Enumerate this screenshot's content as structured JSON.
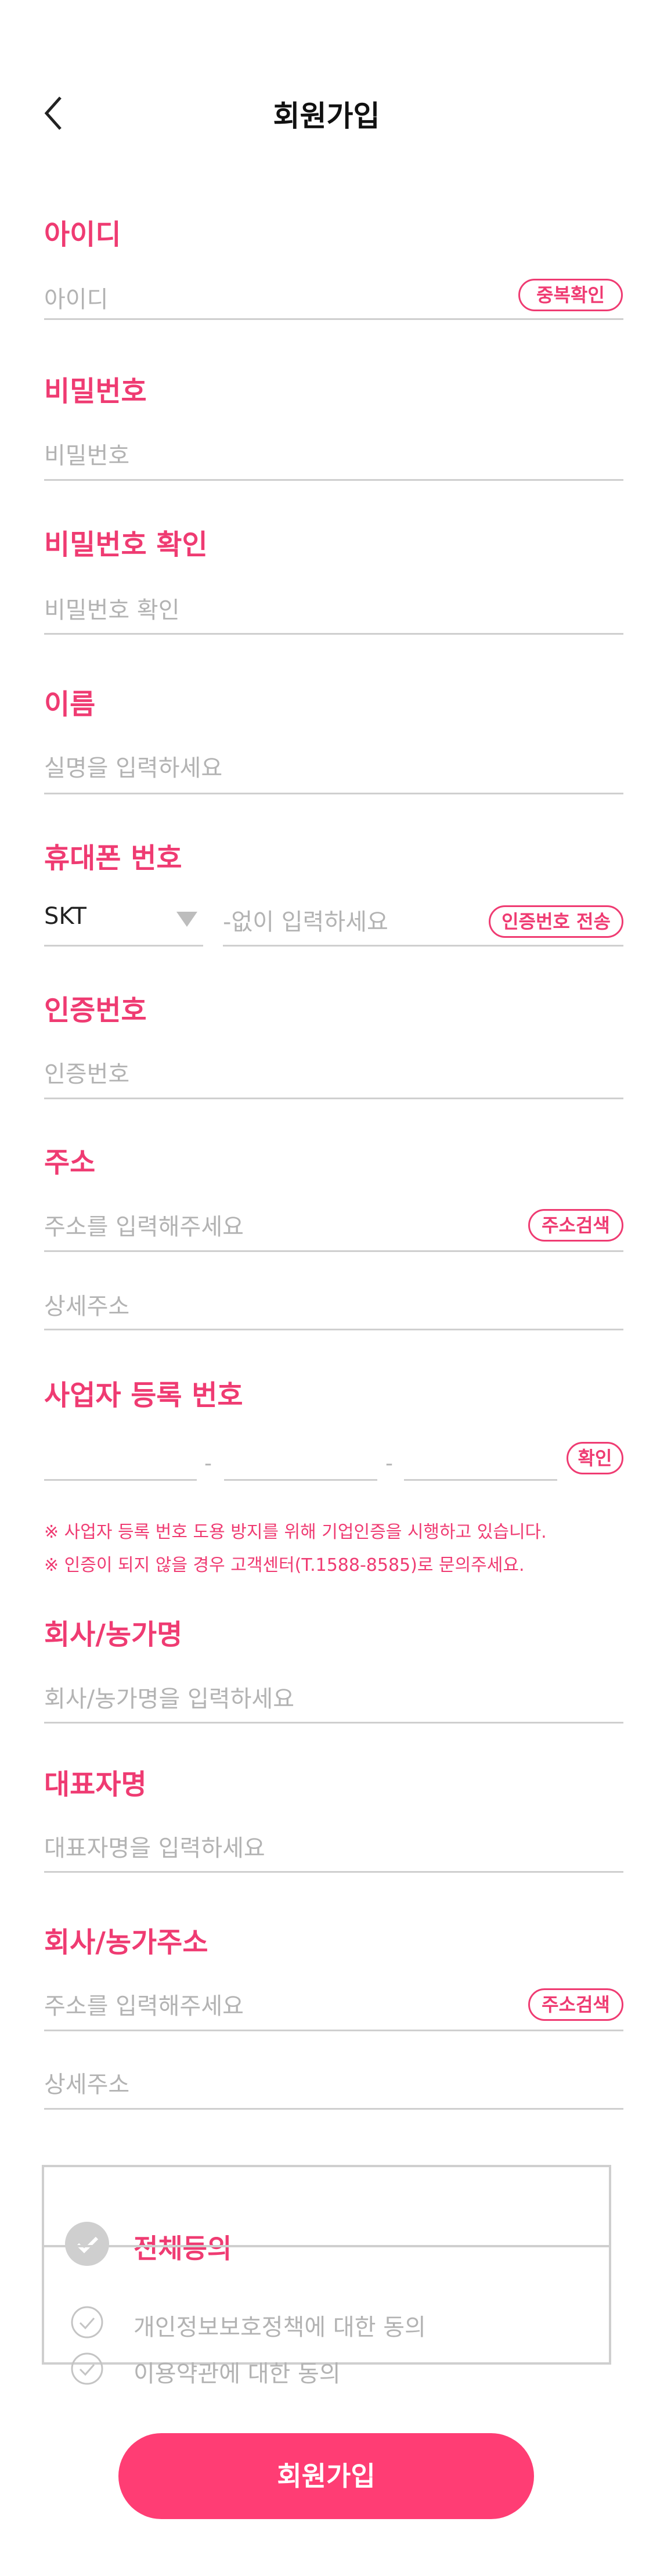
{
  "header": {
    "title": "회원가입"
  },
  "fields": {
    "id": {
      "label": "아이디",
      "placeholder": "아이디",
      "button": "중복확인"
    },
    "password": {
      "label": "비밀번호",
      "placeholder": "비밀번호"
    },
    "password_confirm": {
      "label": "비밀번호 확인",
      "placeholder": "비밀번호 확인"
    },
    "name": {
      "label": "이름",
      "placeholder": "실명을 입력하세요"
    },
    "phone": {
      "label": "휴대폰 번호",
      "carrier": "SKT",
      "placeholder": "-없이 입력하세요",
      "button": "인증번호 전송"
    },
    "auth_code": {
      "label": "인증번호",
      "placeholder": "인증번호"
    },
    "address": {
      "label": "주소",
      "placeholder": "주소를 입력해주세요",
      "button": "주소검색",
      "detail_placeholder": "상세주소"
    },
    "business_number": {
      "label": "사업자 등록 번호",
      "button": "확인",
      "separator": "-",
      "notice1": "※ 사업자 등록 번호 도용 방지를 위해 기업인증을 시행하고 있습니다.",
      "notice2": "※ 인증이 되지 않을 경우 고객센터(T.1588-8585)로 문의주세요."
    },
    "company_name": {
      "label": "회사/농가명",
      "placeholder": "회사/농가명을 입력하세요"
    },
    "ceo_name": {
      "label": "대표자명",
      "placeholder": "대표자명을 입력하세요"
    },
    "company_address": {
      "label": "회사/농가주소",
      "placeholder": "주소를 입력해주세요",
      "button": "주소검색",
      "detail_placeholder": "상세주소"
    }
  },
  "agreements": {
    "all": "전체동의",
    "items": [
      "개인정보보호정책에 대한 동의",
      "이용약관에 대한 동의"
    ]
  },
  "submit": {
    "label": "회원가입"
  },
  "colors": {
    "accent": "#ef3b72",
    "button": "#ff3d74",
    "muted": "#b3b3b3",
    "line": "#cfcfcf"
  },
  "icons": {
    "back": "chevron-left-icon",
    "dropdown": "triangle-down-icon",
    "check": "check-circle-icon"
  }
}
